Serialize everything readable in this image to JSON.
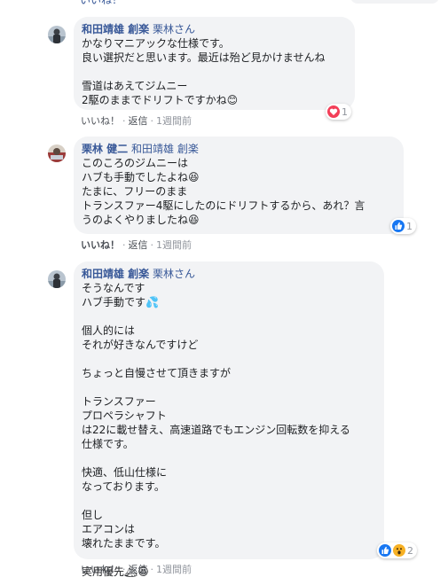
{
  "top": {
    "partial_text": "いいね！"
  },
  "comments": [
    {
      "author": "和田靖雄 創楽",
      "mention": "栗林さん",
      "lines": [
        "かなりマニアックな仕様です。",
        "良い選択だと思います。最近は殆ど見かけませんね",
        "",
        "雪道はあえてジムニー",
        "2駆のままでドリフトですかね😊"
      ],
      "actions": {
        "like": "いいね！",
        "reply": "返信",
        "time": "1週間前"
      },
      "reactions": {
        "icons": [
          "heart-icon"
        ],
        "count": "1"
      }
    },
    {
      "author": "栗林 健二",
      "mention": "和田靖雄 創楽",
      "lines": [
        "このころのジムニーは",
        "ハブも手動でしたよね😆",
        "たまに、フリーのまま",
        "トランスファー4駆にしたのにドリフトするから、あれ？言",
        "うのよくやりましたね😆"
      ],
      "actions": {
        "like": "いいね！",
        "reply": "返信",
        "time": "1週間前"
      },
      "reactions": {
        "icons": [
          "like-icon"
        ],
        "count": "1"
      }
    },
    {
      "author": "和田靖雄 創楽",
      "mention": "栗林さん",
      "lines": [
        "そうなんです",
        "ハブ手動です💦",
        "",
        "個人的には",
        "それが好きなんですけど",
        "",
        "ちょっと自慢させて頂きますが",
        "",
        "トランスファー",
        "プロペラシャフト",
        "は22に載せ替え、高速道路でもエンジン回転数を抑える",
        "仕様です。",
        "",
        "快適、低山仕様に",
        "なっております。",
        "",
        "但し",
        "エアコンは",
        "壊れたままです。",
        "",
        "実用優先🏔😆"
      ],
      "actions": {
        "like": "いいね！",
        "reply": "返信",
        "time": "1週間前"
      },
      "reactions": {
        "icons": [
          "like-icon",
          "wow-icon"
        ],
        "count": "2"
      }
    }
  ]
}
